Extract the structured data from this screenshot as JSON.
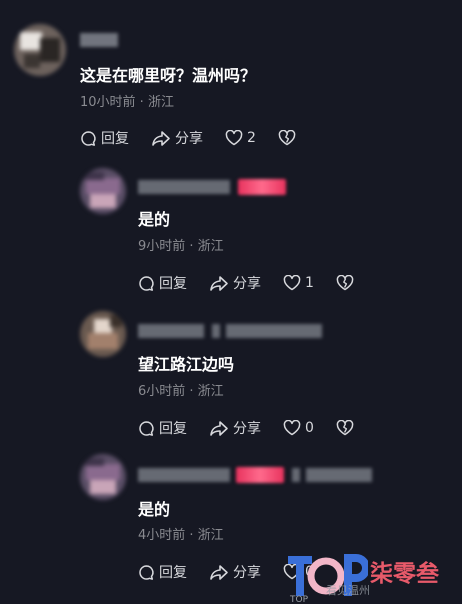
{
  "comments": [
    {
      "text": "这是在哪里呀？温州吗？",
      "meta": "10小时前 · 浙江",
      "reply_label": "回复",
      "share_label": "分享",
      "like_count": "2",
      "like_icon": "heart-icon",
      "dislike_icon": "broken-heart-icon"
    },
    {
      "text": "是的",
      "meta": "9小时前 · 浙江",
      "reply_label": "回复",
      "share_label": "分享",
      "like_count": "1",
      "like_icon": "heart-icon",
      "dislike_icon": "broken-heart-icon"
    },
    {
      "text": "望江路江边吗",
      "meta": "6小时前 · 浙江",
      "reply_label": "回复",
      "share_label": "分享",
      "like_count": "0",
      "like_icon": "heart-icon",
      "dislike_icon": "broken-heart-icon"
    },
    {
      "text": "是的",
      "meta": "4小时前 · 浙江",
      "reply_label": "回复",
      "share_label": "分享",
      "like_count": "0",
      "like_icon": "heart-icon",
      "dislike_icon": "broken-heart-icon"
    }
  ],
  "colors": {
    "background": "#161823",
    "author_tag": "#e8335e",
    "meta_text": "#8a8b91"
  },
  "watermark": {
    "logo_text": "TOP",
    "brand": "柒零叁",
    "subtitle": "看见温州"
  }
}
